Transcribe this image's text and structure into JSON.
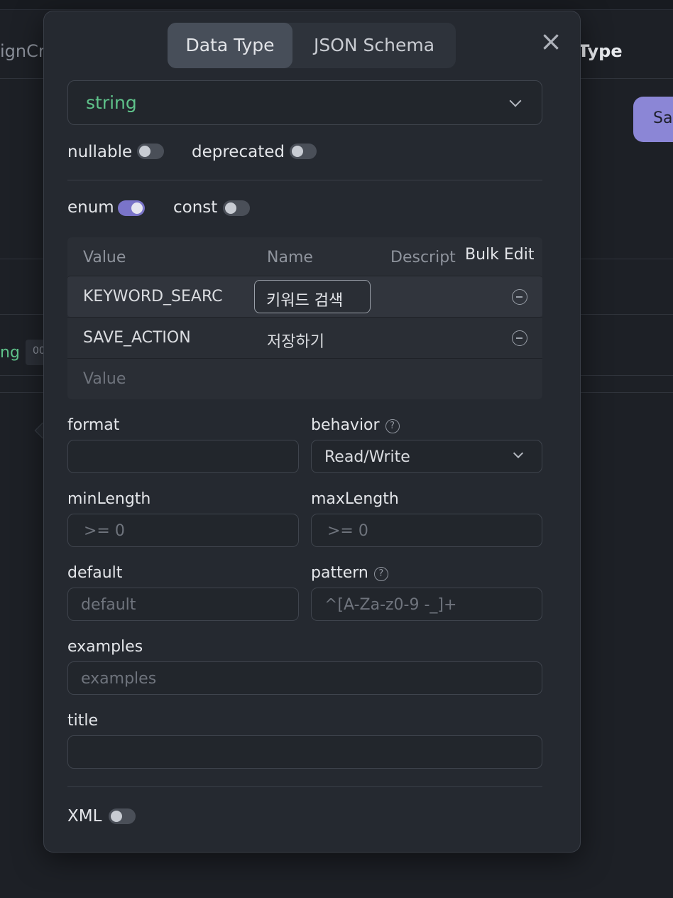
{
  "background": {
    "left_text": "ignCr",
    "right_text": "Type",
    "save_button": "Sa",
    "type_fragment": "ng",
    "chip": "00"
  },
  "modal": {
    "tabs": [
      "Data Type",
      "JSON Schema"
    ],
    "active_tab": "Data Type",
    "close_icon": "×",
    "type_select": {
      "value": "string",
      "value_color": "#5fc28a"
    },
    "toggles": {
      "nullable": {
        "label": "nullable",
        "on": false
      },
      "deprecated": {
        "label": "deprecated",
        "on": false
      },
      "enum": {
        "label": "enum",
        "on": true
      },
      "const": {
        "label": "const",
        "on": false
      },
      "xml": {
        "label": "XML",
        "on": false
      }
    },
    "enum_table": {
      "headers": [
        "Value",
        "Name",
        "Descript"
      ],
      "bulk_edit": "Bulk Edit",
      "rows": [
        {
          "value": "KEYWORD_SEARC",
          "name": "키워드 검색"
        },
        {
          "value": "SAVE_ACTION",
          "name": "저장하기"
        }
      ],
      "new_value_placeholder": "Value"
    },
    "fields": {
      "format": {
        "label": "format",
        "value": ""
      },
      "behavior": {
        "label": "behavior",
        "value": "Read/Write",
        "help": "?"
      },
      "minLength": {
        "label": "minLength",
        "placeholder": ">= 0"
      },
      "maxLength": {
        "label": "maxLength",
        "placeholder": ">= 0"
      },
      "default": {
        "label": "default",
        "placeholder": "default"
      },
      "pattern": {
        "label": "pattern",
        "placeholder": "^[A-Za-z0-9 -_]+",
        "help": "?"
      },
      "examples": {
        "label": "examples",
        "placeholder": "examples"
      },
      "title": {
        "label": "title",
        "value": ""
      }
    },
    "accent_color": "#7a74c9"
  }
}
